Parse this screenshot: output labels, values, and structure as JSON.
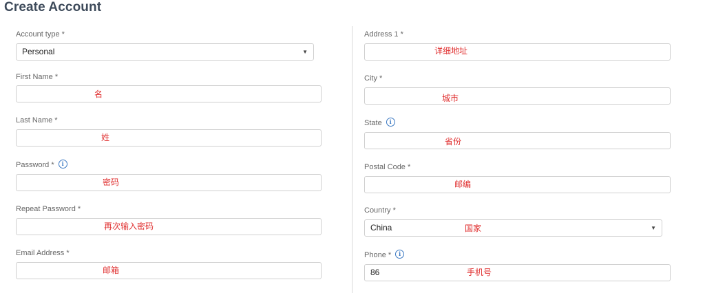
{
  "page": {
    "title": "Create Account"
  },
  "left": {
    "account_type": {
      "label": "Account type *",
      "value": "Personal"
    },
    "first_name": {
      "label": "First Name *",
      "annotation": "名"
    },
    "last_name": {
      "label": "Last Name *",
      "annotation": "姓"
    },
    "password": {
      "label": "Password *",
      "annotation": "密码",
      "icon": "info-icon"
    },
    "repeat_password": {
      "label": "Repeat Password *",
      "annotation": "再次输入密码"
    },
    "email": {
      "label": "Email Address *",
      "annotation": "邮箱"
    }
  },
  "right": {
    "address1": {
      "label": "Address 1 *",
      "annotation": "详细地址"
    },
    "city": {
      "label": "City *",
      "annotation": "城市"
    },
    "state": {
      "label": "State",
      "annotation": "省份",
      "icon": "info-icon"
    },
    "postal_code": {
      "label": "Postal Code *",
      "annotation": "邮编"
    },
    "country": {
      "label": "Country *",
      "value": "China",
      "annotation": "国家"
    },
    "phone": {
      "label": "Phone *",
      "value": "86",
      "annotation": "手机号",
      "icon": "info-icon"
    }
  },
  "colors": {
    "annotation": "#e03030",
    "title": "#3d4a5a",
    "info_icon": "#3a78c2",
    "border": "#cfcfcf"
  }
}
